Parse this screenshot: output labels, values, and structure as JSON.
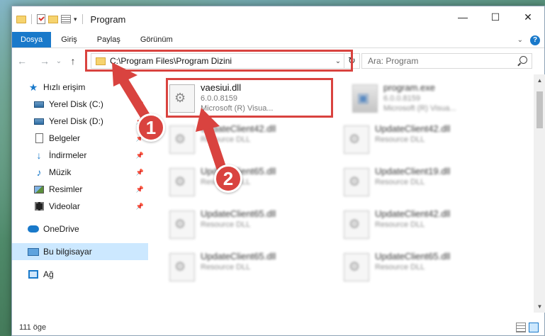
{
  "window": {
    "title": "Program"
  },
  "window_controls": {
    "minimize": "—",
    "maximize": "☐",
    "close": "✕"
  },
  "ribbon": {
    "tabs": [
      "Dosya",
      "Giriş",
      "Paylaş",
      "Görünüm"
    ]
  },
  "navigation": {
    "back": "←",
    "forward": "→",
    "recent": "⌄",
    "up": "↑",
    "address": "C:\\Program Files\\Program Dizini",
    "refresh": "↻",
    "search_placeholder": "Ara: Program"
  },
  "sidebar": {
    "items": [
      {
        "label": "Hızlı erişim",
        "icon": "star-icon",
        "pinned": false
      },
      {
        "label": "Yerel Disk (C:)",
        "icon": "disk-icon",
        "pinned": true
      },
      {
        "label": "Yerel Disk (D:)",
        "icon": "disk-icon",
        "pinned": true
      },
      {
        "label": "Belgeler",
        "icon": "documents-icon",
        "pinned": true
      },
      {
        "label": "İndirmeler",
        "icon": "download-icon",
        "pinned": true
      },
      {
        "label": "Müzik",
        "icon": "music-icon",
        "pinned": true
      },
      {
        "label": "Resimler",
        "icon": "pictures-icon",
        "pinned": true
      },
      {
        "label": "Videolar",
        "icon": "videos-icon",
        "pinned": true
      },
      {
        "label": "OneDrive",
        "icon": "cloud-icon",
        "pinned": false
      },
      {
        "label": "Bu bilgisayar",
        "icon": "computer-icon",
        "pinned": false,
        "selected": true
      },
      {
        "label": "Ağ",
        "icon": "network-icon",
        "pinned": false
      }
    ]
  },
  "files": [
    {
      "name": "vaesiui.dll",
      "line2": "6.0.0.8159",
      "line3": "Microsoft (R) Visua..."
    },
    {
      "name": "program.exe",
      "line2": "6.0.0.8159",
      "line3": "Microsoft (R) Visua..."
    },
    {
      "name": "UpdateClient42.dll",
      "line2": "Resource DLL"
    },
    {
      "name": "UpdateClient42.dll",
      "line2": "Resource DLL"
    },
    {
      "name": "UpdateClient65.dll",
      "line2": "Resource DLL"
    },
    {
      "name": "UpdateClient19.dll",
      "line2": "Resource DLL"
    },
    {
      "name": "UpdateClient65.dll",
      "line2": "Resource DLL"
    },
    {
      "name": "UpdateClient42.dll",
      "line2": "Resource DLL"
    },
    {
      "name": "UpdateClient65.dll",
      "line2": "Resource DLL"
    },
    {
      "name": "UpdateClient65.dll",
      "line2": "Resource DLL"
    }
  ],
  "status": {
    "count": "111 öge"
  },
  "annotations": {
    "step1": "1",
    "step2": "2",
    "color": "#d9433f"
  }
}
